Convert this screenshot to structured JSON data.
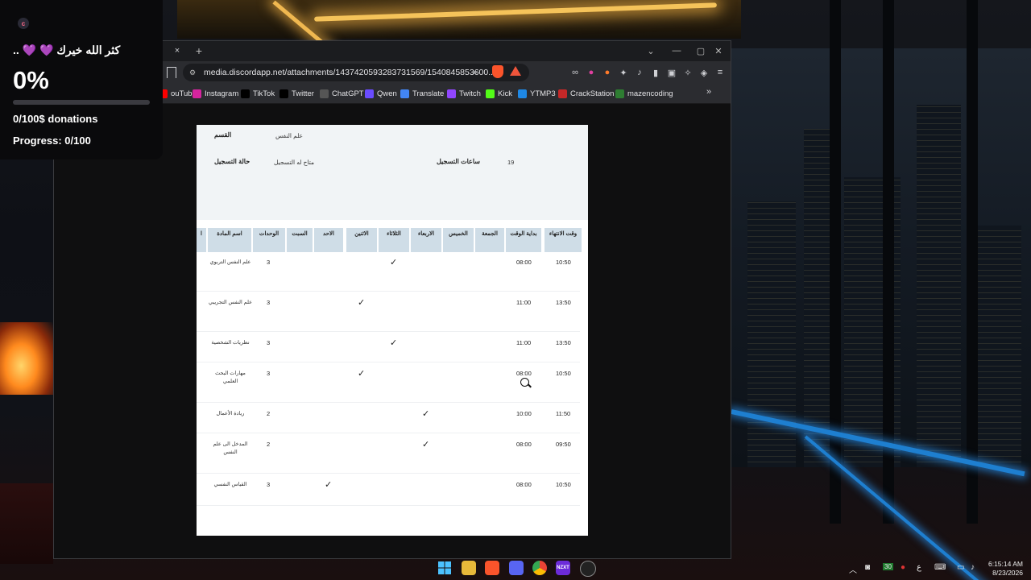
{
  "donation": {
    "message": ".. 💜 💜 كثر الله خيرك",
    "percent": "0%",
    "progress": 0,
    "amount_text": "0/100$ donations",
    "progress_text": "Progress: 0/100"
  },
  "browser": {
    "tab_close": "×",
    "new_tab": "+",
    "url": "media.discordapp.net/attachments/1437420593283731569/1540845853600...",
    "bookmarks": [
      {
        "label": "ouTube",
        "icon": "youtube-icon",
        "color": "#ff0000"
      },
      {
        "label": "Instagram",
        "icon": "instagram-icon",
        "color": "#d6249f"
      },
      {
        "label": "TikTok",
        "icon": "tiktok-icon",
        "color": "#000000"
      },
      {
        "label": "Twitter",
        "icon": "x-icon",
        "color": "#000000"
      },
      {
        "label": "ChatGPT",
        "icon": "chatgpt-icon",
        "color": "#555555"
      },
      {
        "label": "Qwen",
        "icon": "qwen-icon",
        "color": "#6a4cff"
      },
      {
        "label": "Translate",
        "icon": "translate-icon",
        "color": "#4285f4"
      },
      {
        "label": "Twitch",
        "icon": "twitch-icon",
        "color": "#9146ff"
      },
      {
        "label": "Kick",
        "icon": "kick-icon",
        "color": "#53fc18"
      },
      {
        "label": "YTMP3",
        "icon": "ytmp3-icon",
        "color": "#1e88e5"
      },
      {
        "label": "CrackStation",
        "icon": "crackstation-icon",
        "color": "#c62828"
      },
      {
        "label": "mazencoding",
        "icon": "mazencoding-icon",
        "color": "#2e7d32"
      }
    ]
  },
  "schedule": {
    "header": {
      "dept_label": "القسم",
      "dept_value": "علم النفس",
      "status_label": "حالة التسجيل",
      "status_value": "متاح له التسجيل",
      "hours_label": "ساعات التسجيل",
      "hours_value": "19"
    },
    "columns": [
      "وقت الانتهاء",
      "بداية الوقت",
      "الجمعة",
      "الخميس",
      "الاربعاء",
      "الثلاثاء",
      "الاثنين",
      "الاحد",
      "السبت",
      "الوحدات",
      "اسم المادة",
      "ا"
    ],
    "rows": [
      {
        "name": "علم النفس التربوي",
        "units": "3",
        "day": "الثلاثاء",
        "start": "08:00",
        "end": "10:50"
      },
      {
        "name": "علم النفس التجريبي",
        "units": "3",
        "day": "الاثنين",
        "start": "11:00",
        "end": "13:50"
      },
      {
        "name": "نظريات الشخصية",
        "units": "3",
        "day": "الثلاثاء",
        "start": "11:00",
        "end": "13:50"
      },
      {
        "name": "مهارات البحث العلمي",
        "units": "3",
        "day": "الاثنين",
        "start": "08:00",
        "end": "10:50"
      },
      {
        "name": "ريادة الأعمال",
        "units": "2",
        "day": "الاربعاء",
        "start": "10:00",
        "end": "11:50"
      },
      {
        "name": "المدخل الى علم النفس",
        "units": "2",
        "day": "الاربعاء",
        "start": "08:00",
        "end": "09:50"
      },
      {
        "name": "القياس النفسي",
        "units": "3",
        "day": "الاحد",
        "start": "08:00",
        "end": "10:50"
      }
    ],
    "check_mark": "✓"
  },
  "taskbar": {
    "apps": [
      "windows-start-icon",
      "file-explorer-icon",
      "brave-icon",
      "discord-icon",
      "chrome-icon",
      "nzxt-icon",
      "obs-icon"
    ],
    "tray_temp": "30",
    "lang": "ع",
    "time": "6:15:14 AM",
    "date": "8/23/2026"
  }
}
